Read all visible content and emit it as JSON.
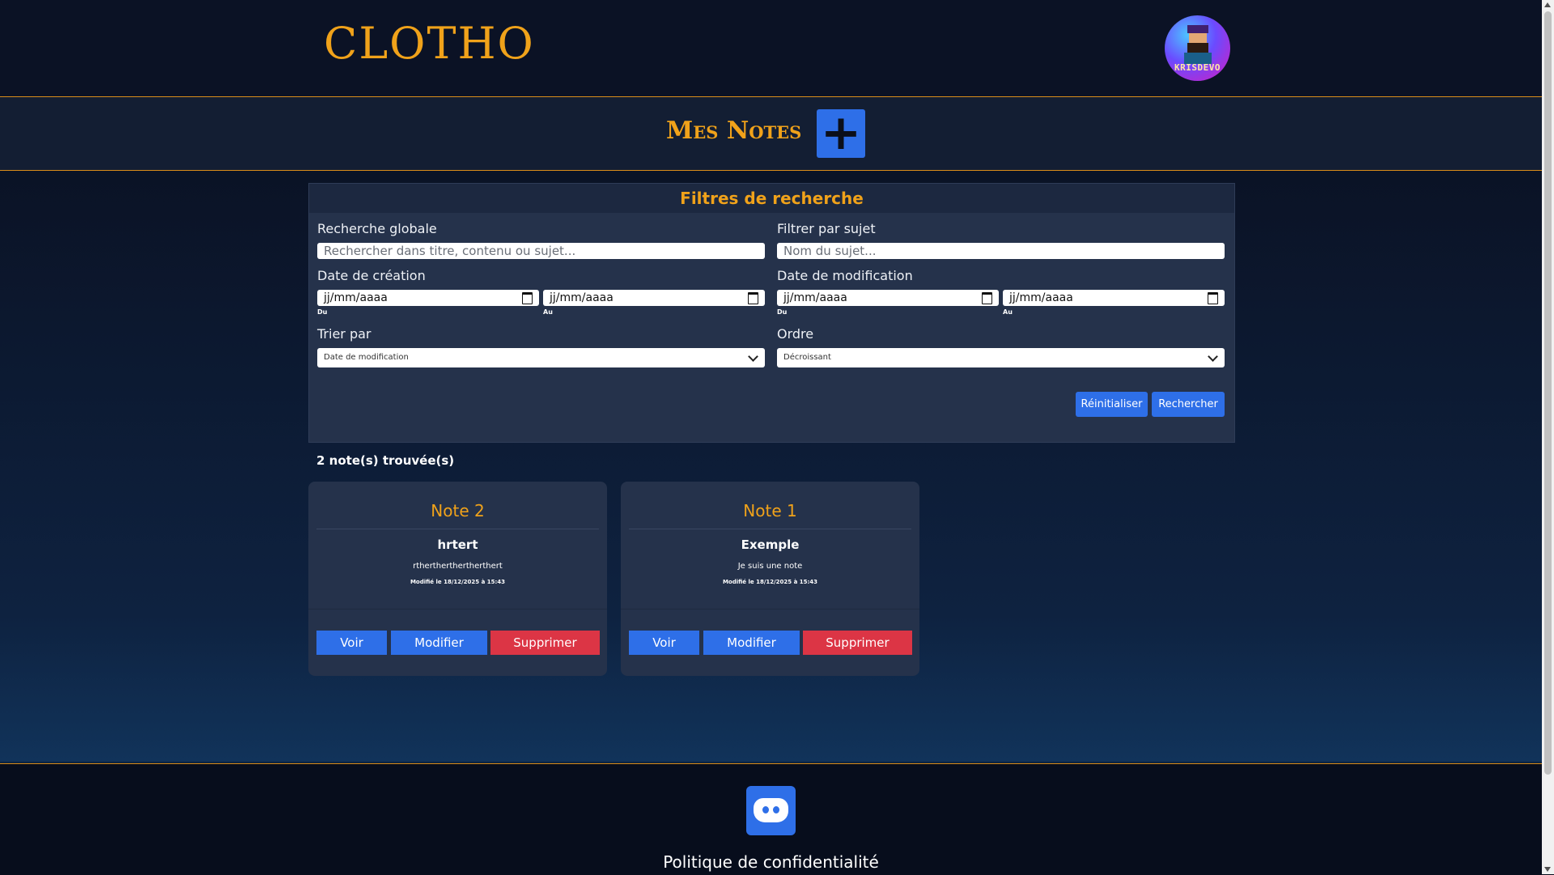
{
  "brand": {
    "logo": "CLOTHO",
    "avatar_label": "KRISDEVO"
  },
  "page": {
    "title": "Mes Notes",
    "add_icon": "+"
  },
  "filters": {
    "heading": "Filtres de recherche",
    "global_label": "Recherche globale",
    "global_placeholder": "Rechercher dans titre, contenu ou sujet...",
    "subject_label": "Filtrer par sujet",
    "subject_placeholder": "Nom du sujet...",
    "created_label": "Date de création",
    "modified_label": "Date de modification",
    "date_placeholder": "jj/mm/aaaa",
    "from_label": "Du",
    "to_label": "Au",
    "sort_label": "Trier par",
    "sort_value": "Date de modification",
    "order_label": "Ordre",
    "order_value": "Décroissant",
    "reset_label": "Réinitialiser",
    "search_label": "Rechercher"
  },
  "results": {
    "count_text": "2 note(s) trouvée(s)"
  },
  "notes": [
    {
      "title": "Note 2",
      "subject": "hrtert",
      "content": "rthertherthertherthert",
      "modified": "Modifié le 18/12/2025 à 15:43",
      "view": "Voir",
      "edit": "Modifier",
      "delete": "Supprimer"
    },
    {
      "title": "Note 1",
      "subject": "Exemple",
      "content": "Je suis une note",
      "modified": "Modifié le 18/12/2025 à 15:43",
      "view": "Voir",
      "edit": "Modifier",
      "delete": "Supprimer"
    }
  ],
  "footer": {
    "privacy": "Politique de confidentialité"
  },
  "colors": {
    "accent": "#f0a21a",
    "primary": "#2e6fe8",
    "danger": "#dc3545",
    "panel": "#25324b"
  }
}
